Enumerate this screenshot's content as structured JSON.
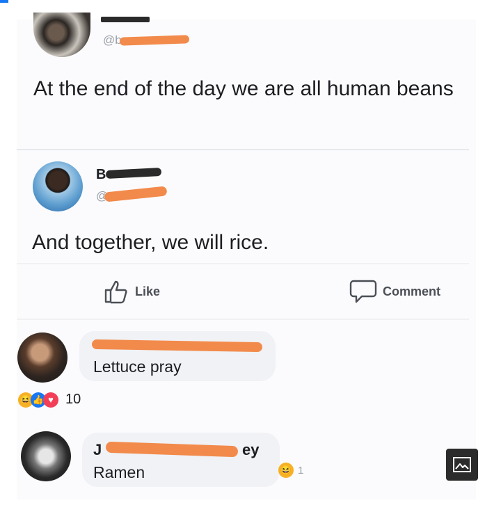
{
  "post1": {
    "text": "At the end of the day we are all human beans",
    "handle_visible": "@b"
  },
  "post2": {
    "name_visible": "B",
    "handle_visible": "@",
    "text": "And together, we will rice."
  },
  "actions": {
    "like_label": "Like",
    "comment_label": "Comment"
  },
  "comment1": {
    "text": "Lettuce pray",
    "reaction_count": "10"
  },
  "comment2": {
    "name_visible": "J",
    "name_suffix_visible": "ey",
    "text": "Ramen",
    "reaction_count": "1"
  },
  "colors": {
    "scribble": "#f28a4b",
    "like_blue": "#1877f2",
    "love_red": "#f33e58",
    "haha_yellow": "#f7b125"
  },
  "icons": [
    "like-icon",
    "comment-icon",
    "haha-reaction-icon",
    "like-reaction-icon",
    "love-reaction-icon",
    "image-icon"
  ]
}
